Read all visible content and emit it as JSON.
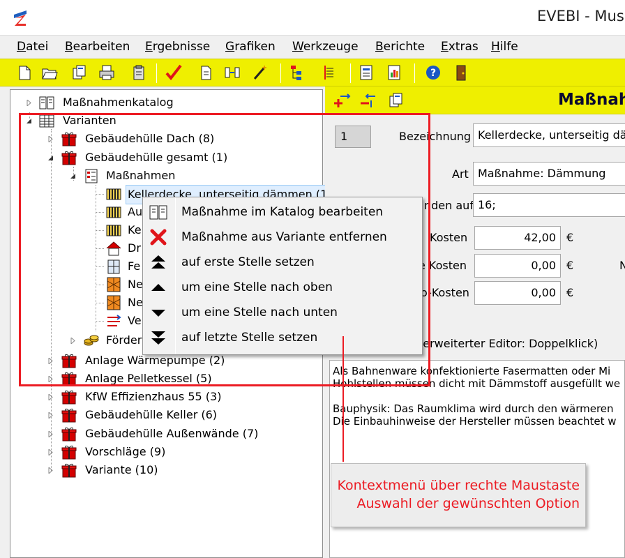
{
  "window": {
    "title": "EVEBI - Mus"
  },
  "menu": [
    "Datei",
    "Bearbeiten",
    "Ergebnisse",
    "Grafiken",
    "Werkzeuge",
    "Berichte",
    "Extras",
    "Hilfe"
  ],
  "toolbar": {
    "icons": [
      "new-file-icon",
      "open-folder-icon",
      "copy-icon",
      "print-icon",
      "clipboard-icon",
      "check-icon",
      "document-icon",
      "compare-icon",
      "wand-icon",
      "hierarchy-icon",
      "list-icon",
      "report-icon",
      "chart-report-icon",
      "help-icon",
      "exit-door-icon"
    ]
  },
  "tree": {
    "catalog": "Maßnahmenkatalog",
    "variants": "Varianten",
    "roof": "Gebäudehülle Dach (8)",
    "envelope": "Gebäudehülle gesamt (1)",
    "measures": "Maßnahmen",
    "m1": "Kellerdecke, unterseitig dämmen (1",
    "m2": "Au",
    "m3": "Ke",
    "m4": "Dr",
    "m5": "Fe",
    "m6": "Ne",
    "m7": "Ne",
    "m8": "Ve",
    "funding": "Förder",
    "heatpump": "Anlage Wärmepumpe (2)",
    "pellet": "Anlage Pelletkessel (5)",
    "kfw": "KfW Effizienzhaus 55 (3)",
    "cellar": "Gebäudehülle Keller (6)",
    "walls": "Gebäudehülle Außenwände (7)",
    "suggestions": "Vorschläge (9)",
    "variant": "Variante (10)"
  },
  "detail": {
    "title": "Maßnah",
    "id": "1",
    "label_bezeichnung": "Bezeichnung",
    "bezeichnung": "Kellerdecke, unterseitig dä",
    "label_art": "Art",
    "art": "Maßnahme: Dämmung",
    "label_bezogen": "nden auf",
    "bezogen": "16;",
    "label_kosten1": "Kosten",
    "kosten1": "42,00",
    "label_kosten2": "e Kosten",
    "kosten2": "0,00",
    "label_kosten3": "o-Kosten",
    "kosten3": "0,00",
    "currency": "€",
    "right_marker": "N",
    "editor_hint": "(erweiterter Editor: Doppelklick)",
    "description": "Als Bahnenware konfektionierte Fasermatten oder Mi\nHohlstellen müssen dicht mit Dämmstoff ausgefüllt we\n\nBauphysik: Das Raumklima wird durch den wärmeren \nDie Einbauhinweise der Hersteller müssen beachtet w"
  },
  "context_menu": {
    "items": [
      {
        "label": "Maßnahme im Katalog bearbeiten",
        "icon": "catalog-book-icon"
      },
      {
        "label": "Maßnahme aus Variante entfernen",
        "icon": "remove-x-icon"
      },
      {
        "label": "auf erste Stelle setzen",
        "icon": "move-first-icon"
      },
      {
        "label": "um eine Stelle nach oben",
        "icon": "move-up-icon"
      },
      {
        "label": "um eine Stelle nach unten",
        "icon": "move-down-icon"
      },
      {
        "label": "auf letzte Stelle setzen",
        "icon": "move-last-icon"
      }
    ]
  },
  "annotation": {
    "line1": "Kontextmenü über rechte Maustaste",
    "line2": "Auswahl der gewünschten Option"
  },
  "colors": {
    "toolbar": "#efef00",
    "accent_red": "#ec1c24",
    "selection": "#dfeefe"
  }
}
